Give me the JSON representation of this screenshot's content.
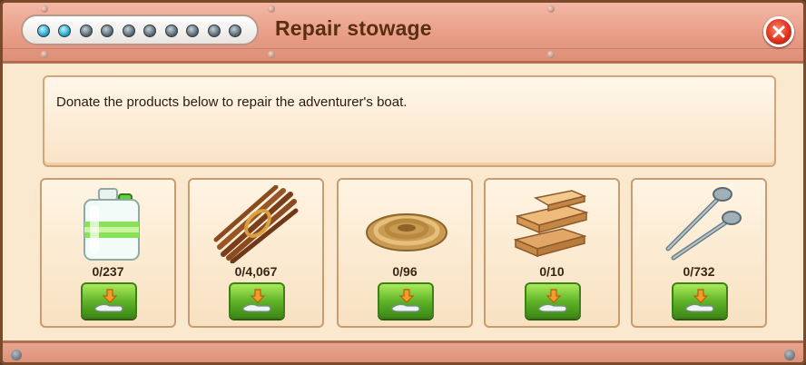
{
  "dialog": {
    "title": "Repair stowage",
    "close_icon": "close-icon",
    "progress_dots": [
      "on",
      "on",
      "off",
      "off",
      "off",
      "off",
      "off",
      "off",
      "off",
      "off"
    ],
    "description": "Donate the products below to repair the adventurer's boat."
  },
  "items": [
    {
      "name": "fuel-canister",
      "icon": "canister-icon",
      "count": "0/237"
    },
    {
      "name": "bundle-of-sticks",
      "icon": "sticks-icon",
      "count": "0/4,067"
    },
    {
      "name": "rope-coil",
      "icon": "rope-icon",
      "count": "0/96"
    },
    {
      "name": "wooden-planks",
      "icon": "planks-icon",
      "count": "0/10"
    },
    {
      "name": "nails",
      "icon": "nails-icon",
      "count": "0/732"
    }
  ],
  "colors": {
    "header": "#e79c86",
    "panel": "#fbe9cf",
    "title_text": "#5a2e12",
    "button_green": "#5db127",
    "close_red": "#e0321c"
  }
}
